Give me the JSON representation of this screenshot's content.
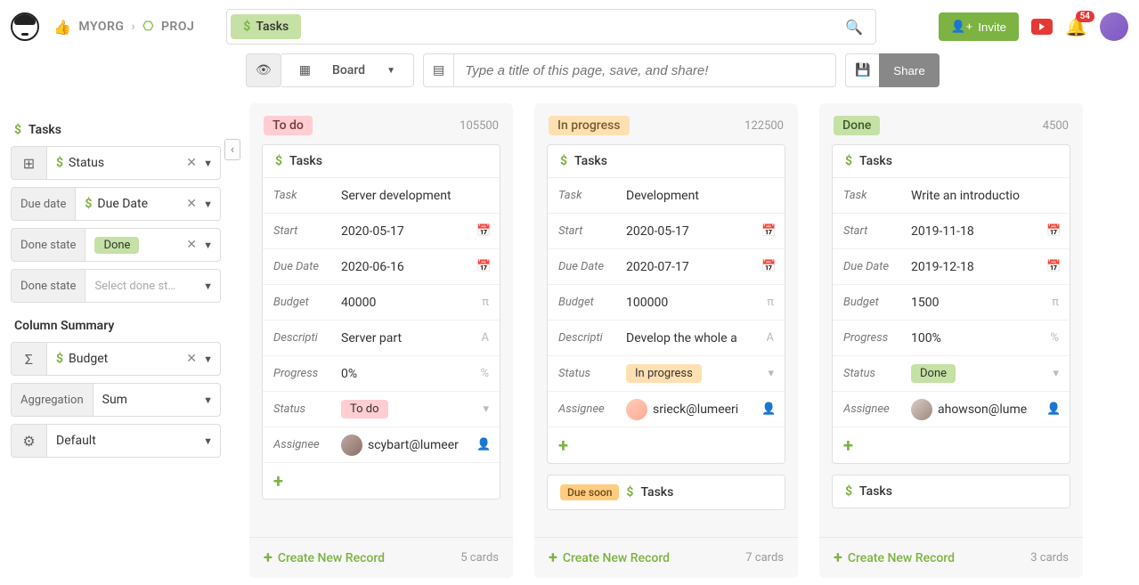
{
  "breadcrumb": {
    "org": "MYORG",
    "proj": "PROJ"
  },
  "search": {
    "chip": "Tasks"
  },
  "header": {
    "invite": "Invite",
    "notif_count": "54"
  },
  "toolbar": {
    "board": "Board",
    "title_placeholder": "Type a title of this page, save, and share!",
    "share": "Share"
  },
  "sidebar": {
    "title": "Tasks",
    "filters": [
      {
        "left_icon": "⊞",
        "label": "Status"
      },
      {
        "left": "Due date",
        "label": "Due Date"
      },
      {
        "left": "Done state",
        "pill": "Done"
      },
      {
        "left": "Done state",
        "placeholder": "Select done st…"
      }
    ],
    "summary_head": "Column Summary",
    "summary": {
      "field": "Budget"
    },
    "agg": {
      "left": "Aggregation",
      "value": "Sum"
    },
    "defaultv": "Default"
  },
  "columns": [
    {
      "title": "To do",
      "class": "todo",
      "sum": "105500",
      "card": {
        "head": "Tasks",
        "rows": [
          {
            "label": "Task",
            "value": "Server development",
            "ic": ""
          },
          {
            "label": "Start",
            "value": "2020-05-17",
            "ic": "📅"
          },
          {
            "label": "Due Date",
            "value": "2020-06-16",
            "ic": "📅"
          },
          {
            "label": "Budget",
            "value": "40000",
            "ic": "π"
          },
          {
            "label": "Descripti",
            "value": "Server part",
            "ic": "A"
          },
          {
            "label": "Progress",
            "value": "0%",
            "ic": "%"
          },
          {
            "label": "Status",
            "value": "To do",
            "status": "todo",
            "ic": "▾"
          },
          {
            "label": "Assignee",
            "value": "scybart@lumeer",
            "avatar": "a1",
            "ic": "👤"
          }
        ]
      },
      "footer": {
        "create": "Create New Record",
        "count": "5 cards"
      }
    },
    {
      "title": "In progress",
      "class": "inprog",
      "sum": "122500",
      "card": {
        "head": "Tasks",
        "rows": [
          {
            "label": "Task",
            "value": "Development",
            "ic": ""
          },
          {
            "label": "Start",
            "value": "2020-05-17",
            "ic": "📅"
          },
          {
            "label": "Due Date",
            "value": "2020-07-17",
            "ic": "📅"
          },
          {
            "label": "Budget",
            "value": "100000",
            "ic": "π"
          },
          {
            "label": "Descripti",
            "value": "Develop the whole a",
            "ic": "A"
          },
          {
            "label": "Status",
            "value": "In progress",
            "status": "inprog",
            "ic": "▾"
          },
          {
            "label": "Assignee",
            "value": "srieck@lumeeri",
            "avatar": "a2",
            "ic": "👤"
          }
        ]
      },
      "stub_badge": "Due soon",
      "stub_title": "Tasks",
      "footer": {
        "create": "Create New Record",
        "count": "7 cards"
      }
    },
    {
      "title": "Done",
      "class": "done-t",
      "sum": "4500",
      "card": {
        "head": "Tasks",
        "rows": [
          {
            "label": "Task",
            "value": "Write an introductio",
            "ic": ""
          },
          {
            "label": "Start",
            "value": "2019-11-18",
            "ic": "📅"
          },
          {
            "label": "Due Date",
            "value": "2019-12-18",
            "ic": "📅"
          },
          {
            "label": "Budget",
            "value": "1500",
            "ic": "π"
          },
          {
            "label": "Progress",
            "value": "100%",
            "ic": "%"
          },
          {
            "label": "Status",
            "value": "Done",
            "status": "done",
            "ic": "▾"
          },
          {
            "label": "Assignee",
            "value": "ahowson@lume",
            "avatar": "a3",
            "ic": "👤"
          }
        ]
      },
      "stub_title": "Tasks",
      "footer": {
        "create": "Create New Record",
        "count": "3 cards"
      }
    }
  ]
}
